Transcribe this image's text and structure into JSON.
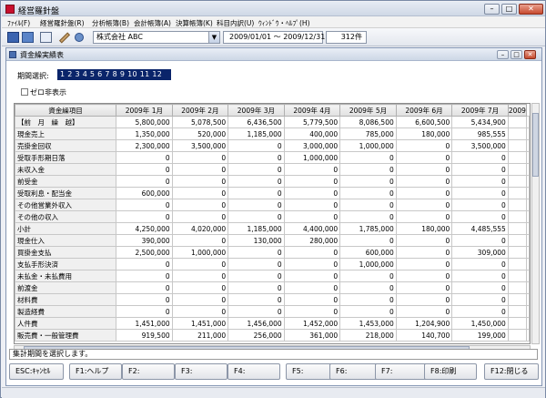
{
  "app": {
    "title": "経営羅針盤"
  },
  "menu": [
    "ﾌｧｲﾙ(F)",
    "経営羅針盤(R)",
    "分析帳簿(B)",
    "会計帳簿(A)",
    "決算帳簿(K)",
    "科目内訳(U)",
    "ｳｨﾝﾄﾞｳ・ﾍﾙﾌﾟ(H)"
  ],
  "toolbar": {
    "company": "株式会社 ABC",
    "period": "2009/01/01 〜 2009/12/31",
    "count": "312件"
  },
  "child": {
    "title": "資金繰実績表"
  },
  "period": {
    "label": "期間選択:",
    "values": "1 2 3 4 5 6 7 8 9 10 11 12"
  },
  "zero_hide": {
    "label": "ゼロ非表示"
  },
  "grid": {
    "header": "資金繰項目",
    "months": [
      "2009年 1月",
      "2009年 2月",
      "2009年 3月",
      "2009年 4月",
      "2009年 5月",
      "2009年 6月",
      "2009年 7月",
      "2009"
    ],
    "rows": [
      {
        "label": "【前　月　繰　越】",
        "v": [
          "5,800,000",
          "5,078,500",
          "6,436,500",
          "5,779,500",
          "8,086,500",
          "6,600,500",
          "5,434,900",
          ""
        ]
      },
      {
        "label": "現金売上",
        "v": [
          "1,350,000",
          "520,000",
          "1,185,000",
          "400,000",
          "785,000",
          "180,000",
          "985,555",
          ""
        ]
      },
      {
        "label": "売掛金回収",
        "v": [
          "2,300,000",
          "3,500,000",
          "0",
          "3,000,000",
          "1,000,000",
          "0",
          "3,500,000",
          ""
        ]
      },
      {
        "label": "受取手形期日落",
        "v": [
          "0",
          "0",
          "0",
          "1,000,000",
          "0",
          "0",
          "0",
          ""
        ]
      },
      {
        "label": "未収入金",
        "v": [
          "0",
          "0",
          "0",
          "0",
          "0",
          "0",
          "0",
          ""
        ]
      },
      {
        "label": "前受金",
        "v": [
          "0",
          "0",
          "0",
          "0",
          "0",
          "0",
          "0",
          ""
        ]
      },
      {
        "label": "受取利息・配当金",
        "v": [
          "600,000",
          "0",
          "0",
          "0",
          "0",
          "0",
          "0",
          ""
        ]
      },
      {
        "label": "その他営業外収入",
        "v": [
          "0",
          "0",
          "0",
          "0",
          "0",
          "0",
          "0",
          ""
        ]
      },
      {
        "label": "その他の収入",
        "v": [
          "0",
          "0",
          "0",
          "0",
          "0",
          "0",
          "0",
          ""
        ]
      },
      {
        "label": "小計",
        "v": [
          "4,250,000",
          "4,020,000",
          "1,185,000",
          "4,400,000",
          "1,785,000",
          "180,000",
          "4,485,555",
          ""
        ]
      },
      {
        "label": "現金仕入",
        "v": [
          "390,000",
          "0",
          "130,000",
          "280,000",
          "0",
          "0",
          "0",
          ""
        ]
      },
      {
        "label": "買掛金支払",
        "v": [
          "2,500,000",
          "1,000,000",
          "0",
          "0",
          "600,000",
          "0",
          "309,000",
          ""
        ]
      },
      {
        "label": "支払手形決済",
        "v": [
          "0",
          "0",
          "0",
          "0",
          "1,000,000",
          "0",
          "0",
          ""
        ]
      },
      {
        "label": "未払金・未払費用",
        "v": [
          "0",
          "0",
          "0",
          "0",
          "0",
          "0",
          "0",
          ""
        ]
      },
      {
        "label": "前渡金",
        "v": [
          "0",
          "0",
          "0",
          "0",
          "0",
          "0",
          "0",
          ""
        ]
      },
      {
        "label": "材料費",
        "v": [
          "0",
          "0",
          "0",
          "0",
          "0",
          "0",
          "0",
          ""
        ]
      },
      {
        "label": "製造経費",
        "v": [
          "0",
          "0",
          "0",
          "0",
          "0",
          "0",
          "0",
          ""
        ]
      },
      {
        "label": "人件費",
        "v": [
          "1,451,000",
          "1,451,000",
          "1,456,000",
          "1,452,000",
          "1,453,000",
          "1,204,900",
          "1,450,000",
          ""
        ]
      },
      {
        "label": "販売費・一般管理費",
        "v": [
          "919,500",
          "211,000",
          "256,000",
          "361,000",
          "218,000",
          "140,700",
          "199,000",
          ""
        ]
      }
    ]
  },
  "status": {
    "text": "集計期間を選択します。"
  },
  "fkeys": [
    "ESC:ｷｬﾝｾﾙ",
    "F1:ヘルプ",
    "F2:",
    "F3:",
    "F4:",
    "F5:",
    "F6:",
    "F7:",
    "F8:印刷",
    "F12:閉じる"
  ]
}
